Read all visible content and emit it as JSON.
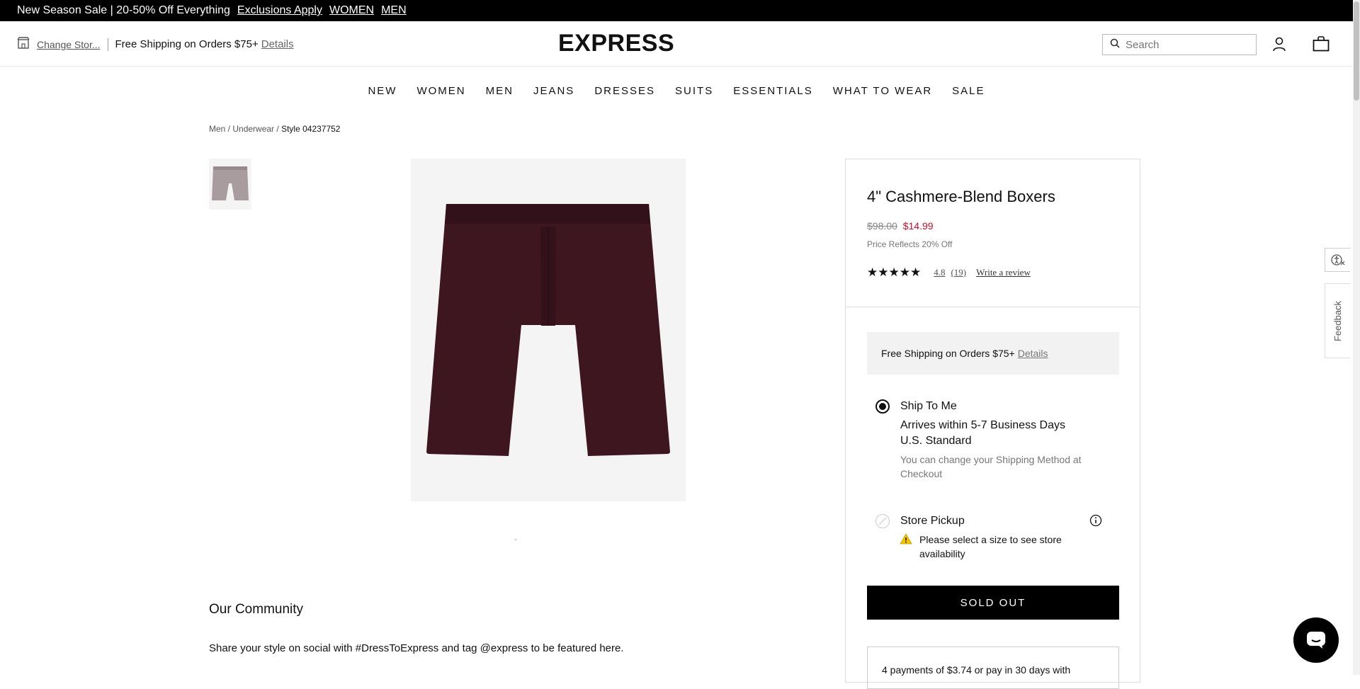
{
  "promo": {
    "text": "New Season Sale | 20-50% Off Everything",
    "links": [
      "Exclusions Apply",
      "WOMEN",
      "MEN"
    ]
  },
  "header": {
    "store_link": "Change Stor...",
    "shipping_text": "Free Shipping on Orders $75+",
    "details_link": "Details",
    "logo": "EXPRESS",
    "search_placeholder": "Search"
  },
  "nav": {
    "items": [
      "NEW",
      "WOMEN",
      "MEN",
      "JEANS",
      "DRESSES",
      "SUITS",
      "ESSENTIALS",
      "WHAT TO WEAR",
      "SALE"
    ]
  },
  "breadcrumb": {
    "items": [
      "Men",
      "Underwear"
    ],
    "current": "Style 04237752"
  },
  "product": {
    "title": "4\" Cashmere-Blend Boxers",
    "old_price": "$98.00",
    "new_price": "$14.99",
    "price_note": "Price Reflects 20% Off",
    "stars": "★★★★★",
    "rating": "4.8",
    "reviews": "(19)",
    "write_review": "Write a review",
    "color": "#3d1620"
  },
  "fulfillment": {
    "shipping_banner": "Free Shipping on Orders $75+",
    "shipping_banner_link": "Details",
    "ship_label": "Ship To Me",
    "ship_line1": "Arrives within 5-7 Business Days",
    "ship_line2": "U.S. Standard",
    "ship_note": "You can change your Shipping Method at Checkout",
    "pickup_label": "Store Pickup",
    "pickup_warning": "Please select a size to see store availability",
    "button": "SOLD OUT",
    "payments": "4 payments of $3.74 or pay in 30 days with"
  },
  "community": {
    "title": "Our Community",
    "text": "Share your style on social with #DressToExpress and tag @express to be featured here."
  },
  "widgets": {
    "feedback": "Feedback"
  }
}
